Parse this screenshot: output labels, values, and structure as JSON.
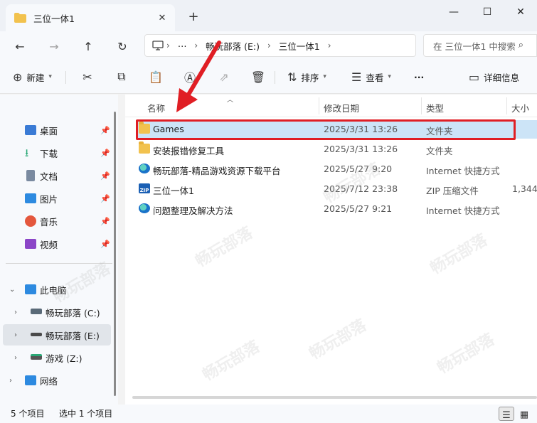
{
  "window": {
    "tab_title": "三位一体1",
    "close_tab": "✕",
    "new_tab": "+",
    "minimize": "—",
    "maximize": "☐",
    "close": "✕"
  },
  "address": {
    "computer_icon": "monitor-icon",
    "more": "⋯",
    "segments": [
      "畅玩部落 (E:)",
      "三位一体1"
    ],
    "search_placeholder": "在 三位一体1 中搜索"
  },
  "toolbar": {
    "new_label": "新建",
    "sort_label": "排序",
    "view_label": "查看",
    "more_label": "···",
    "details_label": "详细信息"
  },
  "sidebar": {
    "quick_access": [
      {
        "label": "桌面",
        "icon": "desktop-icon",
        "color": "#3a7bd5"
      },
      {
        "label": "下载",
        "icon": "download-icon",
        "color": "#2aa876"
      },
      {
        "label": "文档",
        "icon": "document-icon",
        "color": "#7a8aa0"
      },
      {
        "label": "图片",
        "icon": "picture-icon",
        "color": "#2d8ae0"
      },
      {
        "label": "音乐",
        "icon": "music-icon",
        "color": "#e4573d"
      },
      {
        "label": "视频",
        "icon": "video-icon",
        "color": "#8b45c7"
      }
    ],
    "this_pc": "此电脑",
    "drives": [
      {
        "label": "畅玩部落 (C:)",
        "icon": "windows-drive-icon"
      },
      {
        "label": "畅玩部落 (E:)",
        "icon": "drive-icon"
      },
      {
        "label": "游戏 (Z:)",
        "icon": "drive-green-icon"
      }
    ],
    "network": "网络"
  },
  "columns": {
    "name": "名称",
    "date": "修改日期",
    "type": "类型",
    "size": "大小"
  },
  "files": [
    {
      "name": "Games",
      "date": "2025/3/31 13:26",
      "type": "文件夹",
      "size": "",
      "icon": "folder"
    },
    {
      "name": "安装报错修复工具",
      "date": "2025/3/31 13:26",
      "type": "文件夹",
      "size": "",
      "icon": "folder"
    },
    {
      "name": "畅玩部落-精品游戏资源下载平台",
      "date": "2025/5/27 9:20",
      "type": "Internet 快捷方式",
      "size": "",
      "icon": "link"
    },
    {
      "name": "三位一体1",
      "date": "2025/7/12 23:38",
      "type": "ZIP 压缩文件",
      "size": "1,344,",
      "icon": "zip"
    },
    {
      "name": "问题整理及解决方法",
      "date": "2025/5/27 9:21",
      "type": "Internet 快捷方式",
      "size": "",
      "icon": "link"
    }
  ],
  "watermark": "畅玩部落",
  "status": {
    "item_count": "5 个项目",
    "selected": "选中 1 个项目"
  }
}
